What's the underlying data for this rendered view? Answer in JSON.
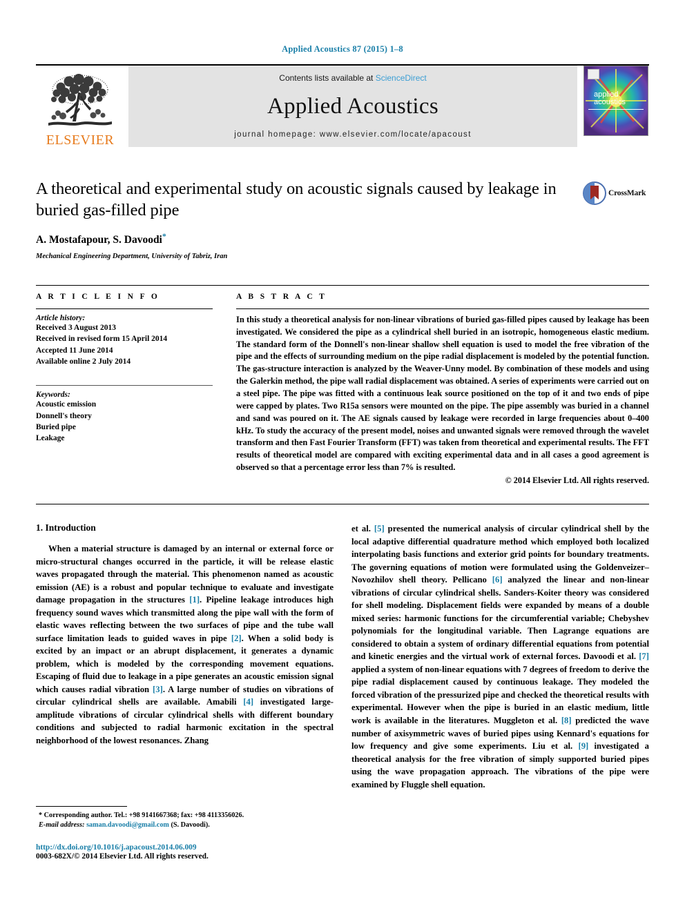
{
  "running_head": "Applied Acoustics 87 (2015) 1–8",
  "masthead": {
    "publisher_name": "ELSEVIER",
    "contents_prefix": "Contents lists available at ",
    "sciencedirect": "ScienceDirect",
    "journal_name": "Applied Acoustics",
    "homepage": "journal homepage: www.elsevier.com/locate/apacoust",
    "cover_title_line1": "applied",
    "cover_title_line2": "acoustics"
  },
  "article": {
    "title": "A theoretical and experimental study on acoustic signals caused by leakage in buried gas-filled pipe",
    "authors": "A. Mostafapour, S. Davoodi",
    "corresponding_marker": "*",
    "affiliation": "Mechanical Engineering Department, University of Tabriz, Iran",
    "crossmark_label": "CrossMark"
  },
  "article_info": {
    "heading": "A R T I C L E   I N F O",
    "history_label": "Article history:",
    "history": [
      "Received 3 August 2013",
      "Received in revised form 15 April 2014",
      "Accepted 11 June 2014",
      "Available online 2 July 2014"
    ],
    "keywords_label": "Keywords:",
    "keywords": [
      "Acoustic emission",
      "Donnell's theory",
      "Buried pipe",
      "Leakage"
    ]
  },
  "abstract": {
    "heading": "A B S T R A C T",
    "text": "In this study a theoretical analysis for non-linear vibrations of buried gas-filled pipes caused by leakage has been investigated. We considered the pipe as a cylindrical shell buried in an isotropic, homogeneous elastic medium. The standard form of the Donnell's non-linear shallow shell equation is used to model the free vibration of the pipe and the effects of surrounding medium on the pipe radial displacement is modeled by the potential function. The gas-structure interaction is analyzed by the Weaver-Unny model. By combination of these models and using the Galerkin method, the pipe wall radial displacement was obtained. A series of experiments were carried out on a steel pipe. The pipe was fitted with a continuous leak source positioned on the top of it and two ends of pipe were capped by plates. Two R15a sensors were mounted on the pipe. The pipe assembly was buried in a channel and sand was poured on it. The AE signals caused by leakage were recorded in large frequencies about 0–400 kHz. To study the accuracy of the present model, noises and unwanted signals were removed through the wavelet transform and then Fast Fourier Transform (FFT) was taken from theoretical and experimental results. The FFT results of theoretical model are compared with exciting experimental data and in all cases a good agreement is observed so that a percentage error less than 7% is resulted.",
    "copyright": "© 2014 Elsevier Ltd. All rights reserved."
  },
  "introduction": {
    "heading": "1. Introduction",
    "left_paragraph_parts": [
      "When a material structure is damaged by an internal or external force or micro-structural changes occurred in the particle, it will be release elastic waves propagated through the material. This phenomenon named as acoustic emission (AE) is a robust and popular technique to evaluate and investigate damage propagation in the structures ",
      "[1]",
      ". Pipeline leakage introduces high frequency sound waves which transmitted along the pipe wall with the form of elastic waves reflecting between the two surfaces of pipe and the tube wall surface limitation leads to guided waves in pipe ",
      "[2]",
      ". When a solid body is excited by an impact or an abrupt displacement, it generates a dynamic problem, which is modeled by the corresponding movement equations. Escaping of fluid due to leakage in a pipe generates an acoustic emission signal which causes radial vibration ",
      "[3]",
      ". A large number of studies on vibrations of circular cylindrical shells are available. Amabili ",
      "[4]",
      " investigated large-amplitude vibrations of circular cylindrical shells with different boundary conditions and subjected to radial harmonic excitation in the spectral neighborhood of the lowest resonances. Zhang"
    ],
    "right_paragraph_parts": [
      "et al. ",
      "[5]",
      " presented the numerical analysis of circular cylindrical shell by the local adaptive differential quadrature method which employed both localized interpolating basis functions and exterior grid points for boundary treatments. The governing equations of motion were formulated using the Goldenveizer–Novozhilov shell theory. Pellicano ",
      "[6]",
      " analyzed the linear and non-linear vibrations of circular cylindrical shells. Sanders-Koiter theory was considered for shell modeling. Displacement fields were expanded by means of a double mixed series: harmonic functions for the circumferential variable; Chebyshev polynomials for the longitudinal variable. Then Lagrange equations are considered to obtain a system of ordinary differential equations from potential and kinetic energies and the virtual work of external forces. Davoodi et al. ",
      "[7]",
      " applied a system of non-linear equations with 7 degrees of freedom to derive the pipe radial displacement caused by continuous leakage. They modeled the forced vibration of the pressurized pipe and checked the theoretical results with experimental. However when the pipe is buried in an elastic medium, little work is available in the literatures. Muggleton et al. ",
      "[8]",
      " predicted the wave number of axisymmetric waves of buried pipes using Kennard's equations for low frequency and give some experiments. Liu et al. ",
      "[9]",
      " investigated a theoretical analysis for the free vibration of simply supported buried pipes using the wave propagation approach. The vibrations of the pipe were examined by Fluggle shell equation."
    ]
  },
  "footnotes": {
    "corresponding_marker": "*",
    "corresponding_text": "Corresponding author. Tel.: +98 9141667368; fax: +98 4113356026.",
    "email_label": "E-mail address:",
    "email": "saman.davoodi@gmail.com",
    "email_owner": "(S. Davoodi)."
  },
  "footer": {
    "doi": "http://dx.doi.org/10.1016/j.apacoust.2014.06.009",
    "issn_line": "0003-682X/© 2014 Elsevier Ltd. All rights reserved."
  },
  "colors": {
    "link_blue": "#1a7fa8",
    "sciencedirect_blue": "#3d9fd4",
    "elsevier_orange": "#e77b1d",
    "band_gray": "#e3e3e3"
  }
}
